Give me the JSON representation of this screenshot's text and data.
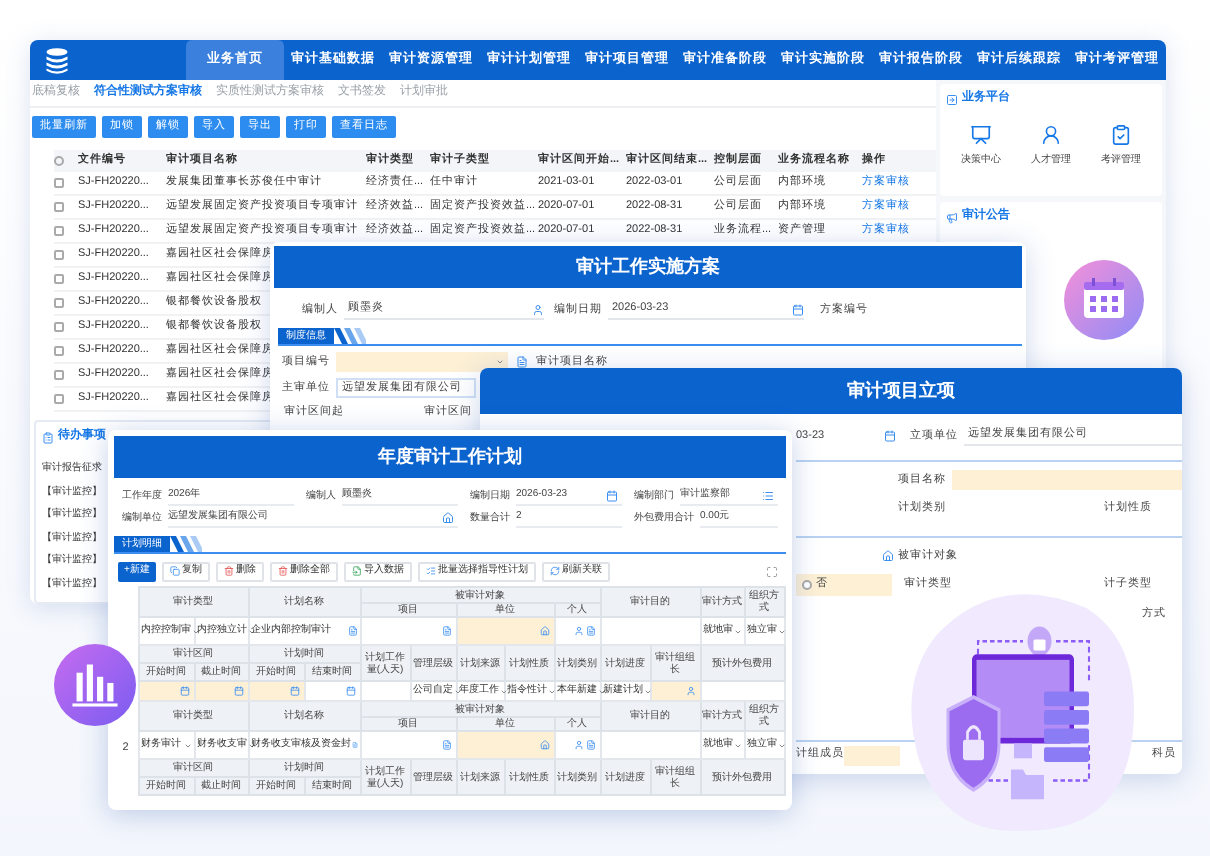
{
  "main_window": {
    "nav_tabs": [
      {
        "label": "业务首页",
        "selected": true
      },
      {
        "label": "审计基础数据",
        "selected": false
      },
      {
        "label": "审计资源管理",
        "selected": false
      },
      {
        "label": "审计计划管理",
        "selected": false
      },
      {
        "label": "审计项目管理",
        "selected": false
      },
      {
        "label": "审计准备阶段",
        "selected": false
      },
      {
        "label": "审计实施阶段",
        "selected": false
      },
      {
        "label": "审计报告阶段",
        "selected": false
      },
      {
        "label": "审计后续跟踪",
        "selected": false
      },
      {
        "label": "审计考评管理",
        "selected": false
      }
    ],
    "sub_tabs": [
      {
        "label": "底稿复核",
        "selected": false
      },
      {
        "label": "符合性测试方案审核",
        "selected": true
      },
      {
        "label": "实质性测试方案审核",
        "selected": false
      },
      {
        "label": "文书签发",
        "selected": false
      },
      {
        "label": "计划审批",
        "selected": false
      }
    ],
    "toolbar": [
      "批量刷新",
      "加锁",
      "解锁",
      "导入",
      "导出",
      "打印",
      "查看日志"
    ],
    "table": {
      "all_checked": false,
      "columns": [
        "文件编号",
        "审计项目名称",
        "审计类型",
        "审计子类型",
        "审计区间开始...",
        "审计区间结束...",
        "控制层面",
        "业务流程名称",
        "操作"
      ],
      "rows": [
        {
          "checked": false,
          "cells": [
            "SJ-FH20220...",
            "发展集团董事长苏俊任中审计",
            "经济责任...",
            "任中审计",
            "2021-03-01",
            "2022-03-01",
            "公司层面",
            "内部环境"
          ],
          "action": "方案审核"
        },
        {
          "checked": false,
          "cells": [
            "SJ-FH20220...",
            "远望发展固定资产投资项目专项审计",
            "经济效益...",
            "固定资产投资效益...",
            "2020-07-01",
            "2022-08-31",
            "公司层面",
            "内部环境"
          ],
          "action": "方案审核"
        },
        {
          "checked": false,
          "cells": [
            "SJ-FH20220...",
            "远望发展固定资产投资项目专项审计",
            "经济效益...",
            "固定资产投资效益...",
            "2020-07-01",
            "2022-08-31",
            "业务流程...",
            "资产管理"
          ],
          "action": "方案审核"
        },
        {
          "checked": false,
          "cells": [
            "SJ-FH20220...",
            "嘉园社区社会保障房"
          ]
        },
        {
          "checked": false,
          "cells": [
            "SJ-FH20220...",
            "嘉园社区社会保障房"
          ]
        },
        {
          "checked": false,
          "cells": [
            "SJ-FH20220...",
            "银都餐饮设备股权"
          ]
        },
        {
          "checked": false,
          "cells": [
            "SJ-FH20220...",
            "银都餐饮设备股权"
          ]
        },
        {
          "checked": false,
          "cells": [
            "SJ-FH20220...",
            "嘉园社区社会保障房"
          ]
        },
        {
          "checked": false,
          "cells": [
            "SJ-FH20220...",
            "嘉园社区社会保障房"
          ]
        },
        {
          "checked": false,
          "cells": [
            "SJ-FH20220...",
            "嘉园社区社会保障房"
          ]
        }
      ]
    },
    "todo": {
      "title": "待办事项",
      "items": [
        "审计报告征求",
        "【审计监控】",
        "【审计监控】",
        "【审计监控】",
        "【审计监控】",
        "【审计监控】"
      ]
    },
    "platform": {
      "title": "业务平台",
      "items": [
        {
          "label": "决策中心",
          "kind": "chart"
        },
        {
          "label": "人才管理",
          "kind": "person"
        },
        {
          "label": "考评管理",
          "kind": "clipboard"
        }
      ]
    },
    "notice": {
      "title": "审计公告"
    }
  },
  "plan_window": {
    "title": "审计工作实施方案",
    "editor_label": "编制人",
    "editor": "顾墨炎",
    "date_label": "编制日期",
    "date": "2026-03-23",
    "number_label": "方案编号",
    "section": "制度信息",
    "project_no_label": "项目编号",
    "project_name_label": "审计项目名称",
    "lead_unit_label": "主审单位",
    "lead_unit": "远望发展集团有限公司",
    "period_start_label": "审计区间起",
    "period_end_label": "审计区间"
  },
  "project_window": {
    "title": "审计项目立项",
    "date": "03-23",
    "unit_label": "立项单位",
    "unit": "远望发展集团有限公司",
    "project_name_label": "项目名称",
    "plan_category_label": "计划类别",
    "plan_nature_label": "计划性质",
    "audited_object_label": "被审计对象",
    "option": {
      "label": "否",
      "selected": false
    },
    "audit_type_label": "审计类型",
    "audit_subtype_label": "计子类型",
    "method_label": "方式",
    "members_label": "计组成员",
    "clerk_label": "科员"
  },
  "annual_window": {
    "title": "年度审计工作计划",
    "fields": [
      {
        "label": "工作年度",
        "value": "2026年"
      },
      {
        "label": "编制人",
        "value": "顾墨炎"
      },
      {
        "label": "编制日期",
        "value": "2026-03-23"
      },
      {
        "label": "编制部门",
        "value": "审计监察部"
      },
      {
        "label": "编制单位",
        "value": "远望发展集团有限公司"
      },
      {
        "label": "数量合计",
        "value": "2"
      },
      {
        "label": "外包费用合计",
        "value": "0.00元"
      }
    ],
    "section": "计划明细",
    "toolbar": [
      {
        "label": "+新建",
        "kind": "primary"
      },
      {
        "label": "复制",
        "kind": "copy"
      },
      {
        "label": "删除",
        "kind": "delete"
      },
      {
        "label": "删除全部",
        "kind": "delete"
      },
      {
        "label": "导入数据",
        "kind": "import"
      },
      {
        "label": "批量选择指导性计划",
        "kind": "select"
      },
      {
        "label": "刷新关联",
        "kind": "refresh"
      }
    ],
    "groups": [
      {
        "top_headers": [
          "审计类型",
          "计划名称",
          "被审计对象",
          "项目",
          "单位",
          "个人",
          "审计目的",
          "审计方式",
          "组织方式"
        ],
        "top_values": {
          "type": "内控控制审",
          "subtype": "内控独立计",
          "name": "企业内部控制审计",
          "way": "就地审",
          "org": "独立审"
        },
        "bottom_headers": [
          "审计区间",
          "开始时间",
          "截止时间",
          "计划时间",
          "开始时间",
          "结束时间",
          "计划工作量(人天)",
          "管理层级",
          "计划来源",
          "计划性质",
          "计划类别",
          "计划进度",
          "审计组组长",
          "预计外包费用"
        ],
        "bottom_values": [
          "公司自定",
          "年度工作",
          "指令性计",
          "本年新建",
          "新建计划"
        ]
      },
      {
        "number": "2",
        "top_headers": [
          "审计类型",
          "计划名称",
          "被审计对象",
          "项目",
          "单位",
          "个人",
          "审计目的",
          "审计方式",
          "组织方式"
        ],
        "top_values": {
          "type": "财务审计",
          "subtype": "财务收支审",
          "name": "财务收支审核及资金封",
          "way": "就地审",
          "org": "独立审"
        },
        "bottom_headers": [
          "审计区间",
          "开始时间",
          "截止时间",
          "计划时间",
          "开始时间",
          "结束时间",
          "计划工作量(人天)",
          "管理层级",
          "计划来源",
          "计划性质",
          "计划类别",
          "计划进度",
          "审计组组长",
          "预计外包费用"
        ]
      }
    ]
  }
}
